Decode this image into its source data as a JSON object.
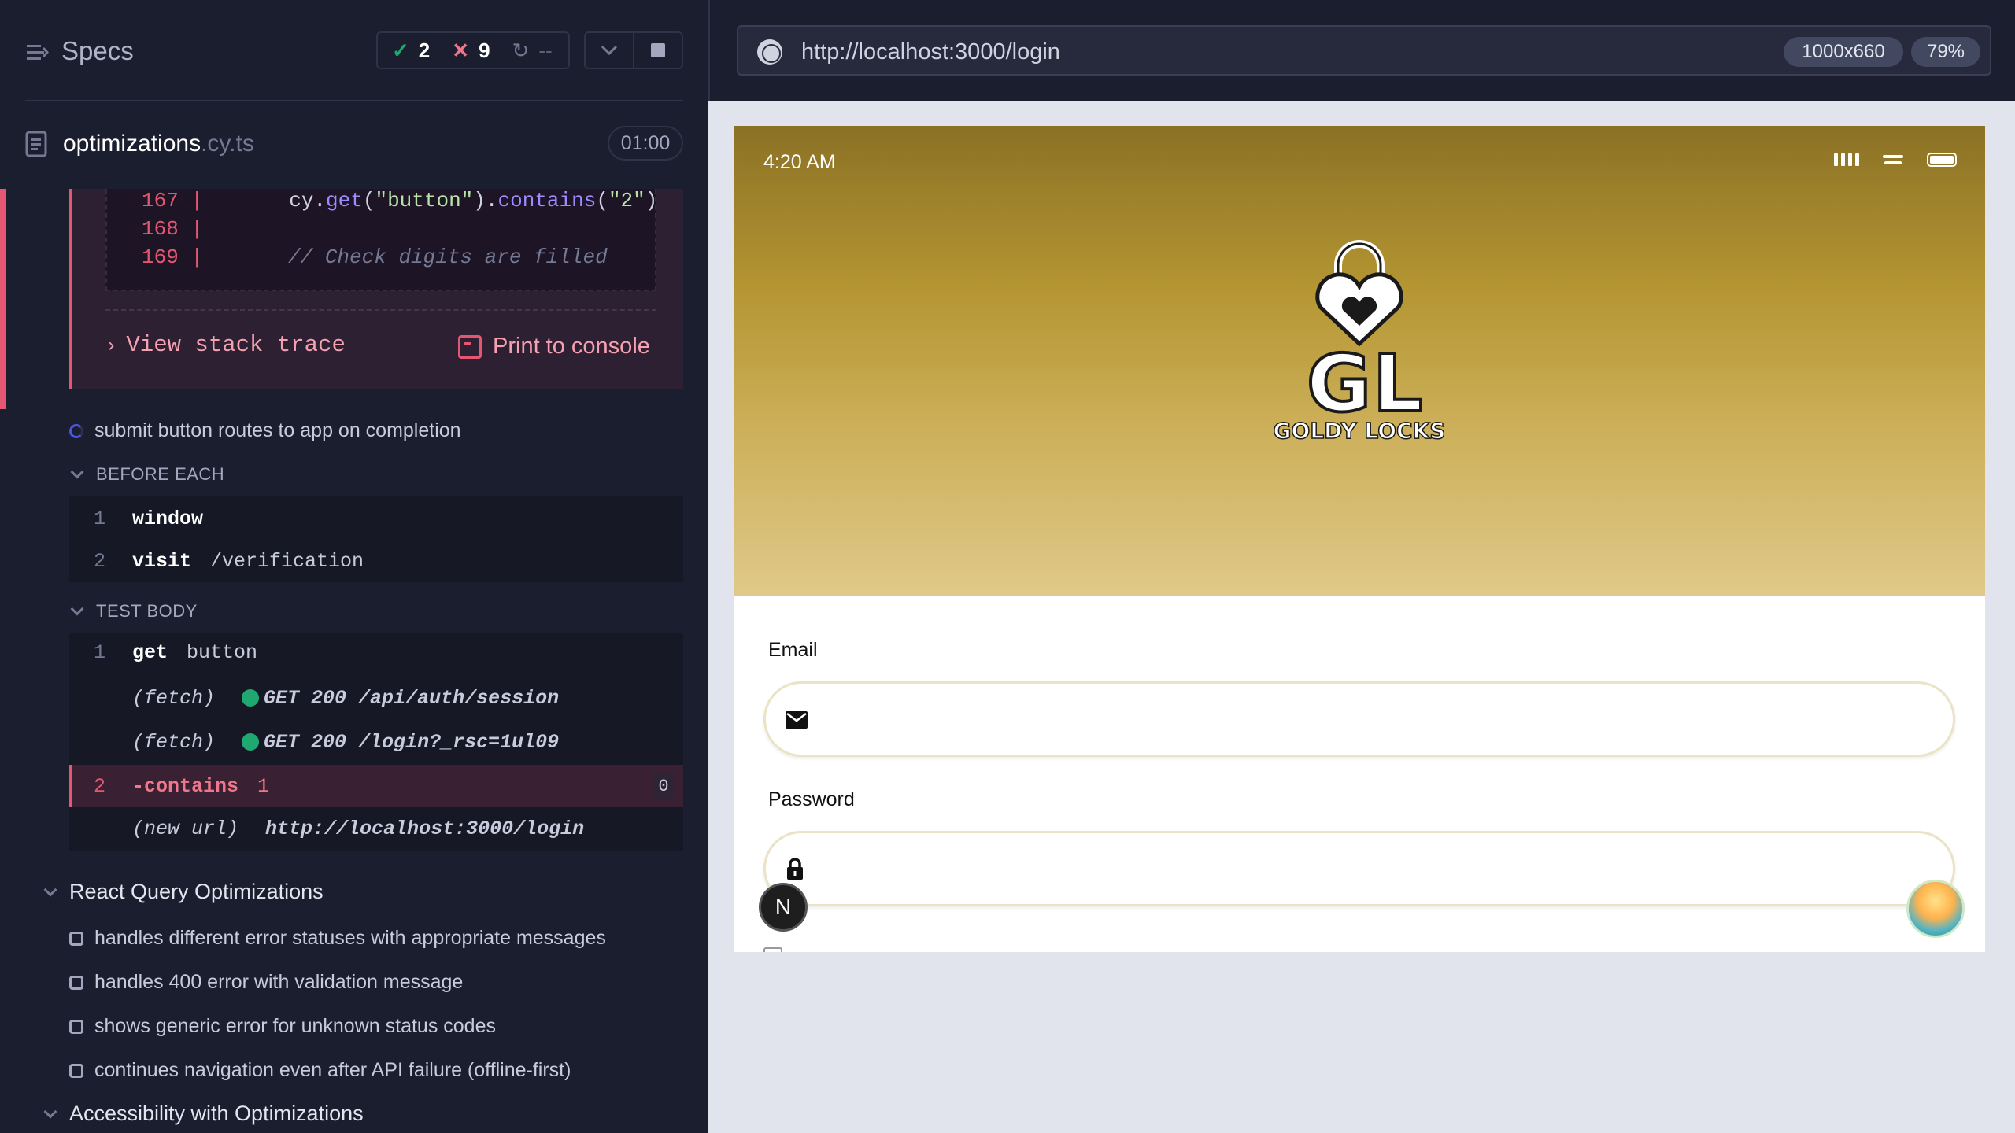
{
  "reporter": {
    "specs_label": "Specs",
    "stats": {
      "passed": "2",
      "failed": "9",
      "pending": "--"
    },
    "spec": {
      "name": "optimizations",
      "ext": ".cy.ts",
      "duration": "01:00"
    },
    "error": {
      "code_lines": [
        {
          "num": "167 |",
          "indent": "       ",
          "parts": [
            {
              "t": "cy.",
              "k": "def"
            },
            {
              "t": "get",
              "k": "fn"
            },
            {
              "t": "(",
              "k": "def"
            },
            {
              "t": "\"button\"",
              "k": "str"
            },
            {
              "t": ").",
              "k": "def"
            },
            {
              "t": "contains",
              "k": "fn"
            },
            {
              "t": "(",
              "k": "def"
            },
            {
              "t": "\"2\"",
              "k": "str"
            },
            {
              "t": ")",
              "k": "def"
            }
          ]
        },
        {
          "num": "168 |",
          "indent": "",
          "parts": []
        },
        {
          "num": "169 |",
          "indent": "       ",
          "parts": [
            {
              "t": "// Check digits are filled",
              "k": "com"
            }
          ]
        }
      ],
      "stack_trace_label": "View stack trace",
      "print_label": "Print to console"
    },
    "current_test": {
      "title": "submit button routes to app on completion",
      "before_each_label": "BEFORE EACH",
      "before_each": [
        {
          "num": "1",
          "name": "window",
          "arg": ""
        },
        {
          "num": "2",
          "name": "visit",
          "arg": "/verification"
        }
      ],
      "test_body_label": "TEST BODY",
      "test_body": [
        {
          "num": "1",
          "name": "get",
          "arg": "button"
        },
        {
          "event": "(fetch)",
          "detail": "GET 200 /api/auth/session"
        },
        {
          "event": "(fetch)",
          "detail": "GET 200 /login?_rsc=1ul09"
        },
        {
          "num": "2",
          "name": "-contains",
          "arg": "1",
          "badge": "0",
          "failed": true
        },
        {
          "event": "(new url)",
          "detail": "http://localhost:3000/login"
        }
      ]
    },
    "suites": [
      {
        "title": "React Query Optimizations",
        "tests": [
          "handles different error statuses with appropriate messages",
          "handles 400 error with validation message",
          "shows generic error for unknown status codes",
          "continues navigation even after API failure (offline-first)"
        ]
      },
      {
        "title": "Accessibility with Optimizations",
        "tests": []
      }
    ]
  },
  "aut": {
    "url": "http://localhost:3000/login",
    "viewport_size": "1000x660",
    "zoom": "79%",
    "app": {
      "status_time": "4:20 AM",
      "brand": "GOLDY LOCKS",
      "brand_initials_left": "G",
      "brand_initials_right": "L",
      "email_label": "Email",
      "password_label": "Password",
      "email_value": "",
      "password_value": "",
      "dev_badge": "N",
      "hero_colors": [
        "#8b7125",
        "#e0c98a"
      ]
    }
  }
}
